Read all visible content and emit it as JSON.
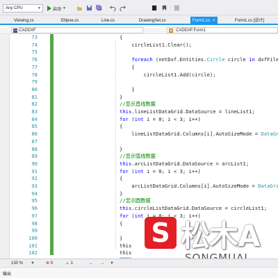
{
  "toolbar": {
    "cpu_config": "Any CPU",
    "start_label": "启动",
    "icons": [
      "dropdown-arrow-icon",
      "play-icon",
      "open-folder-icon",
      "save-icon",
      "save-all-icon",
      "undo-icon",
      "redo-icon",
      "breakpoint-icon",
      "bookmark-icon"
    ]
  },
  "tabs": [
    {
      "label": "Viewing.cs",
      "active": false
    },
    {
      "label": "Ellipse.cs",
      "active": false
    },
    {
      "label": "Line.cs",
      "active": false
    },
    {
      "label": "DrawingSet.cs",
      "active": false
    },
    {
      "label": "Form1.cs",
      "active": true
    },
    {
      "label": "Form1.cs [设计]",
      "active": false
    }
  ],
  "tab_close": "×",
  "navbar": {
    "project": "CADDXF",
    "class": "CADDXF.Form1"
  },
  "editor": {
    "line_numbers": [
      "73",
      "74",
      "75",
      "76",
      "77",
      "78",
      "79",
      "80",
      "81",
      "82",
      "83",
      "84",
      "85",
      "86",
      "87",
      "88",
      "89",
      "90",
      "91",
      "92",
      "93",
      "94",
      "95",
      "96",
      "97",
      "98",
      "99",
      "100",
      "101",
      "102"
    ]
  },
  "statusbar": {
    "zoom": "130 %",
    "errors": "0",
    "warnings": "1"
  },
  "output_panel": {
    "title": "输出"
  },
  "watermark": {
    "badge": "S",
    "chinese": "松木A",
    "english": "SONGMUAI"
  },
  "colors": {
    "accent": "#1c97ea",
    "keyword": "#0000ff",
    "type": "#2b91af",
    "comment": "#008000",
    "change_bar": "#57a64a",
    "watermark_red": "#e31e25"
  }
}
